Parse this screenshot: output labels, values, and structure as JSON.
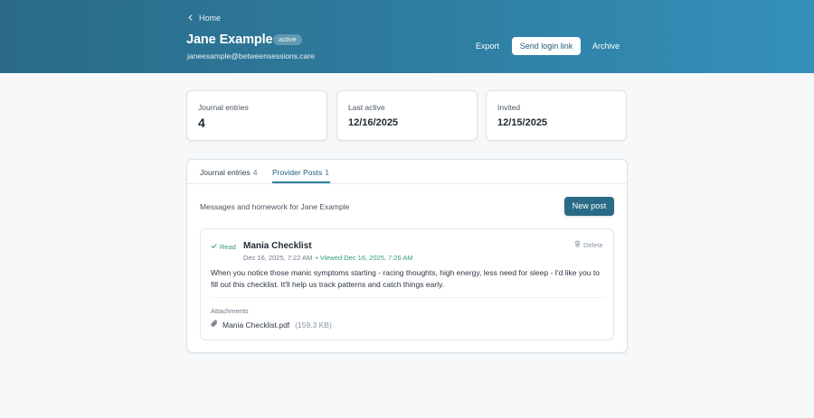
{
  "header": {
    "back_label": "Home",
    "patient_name": "Jane Example",
    "status": "active",
    "email": "janeexample@betweensessions.care",
    "export_label": "Export",
    "send_login_label": "Send login link",
    "archive_label": "Archive"
  },
  "stats": [
    {
      "label": "Journal entries",
      "value": "4"
    },
    {
      "label": "Last active",
      "value": "12/16/2025"
    },
    {
      "label": "Invited",
      "value": "12/15/2025"
    }
  ],
  "tabs": [
    {
      "label": "Journal entries",
      "count": "4"
    },
    {
      "label": "Provider Posts",
      "count": "1",
      "active": true
    }
  ],
  "posts_section": {
    "description": "Messages and homework for Jane Example",
    "new_post_label": "New post"
  },
  "post": {
    "read_label": "Read",
    "title": "Mania Checklist",
    "date": "Dec 16, 2025, 7:22 AM",
    "viewed": "• Viewed Dec 16, 2025, 7:26 AM",
    "delete_label": "Delete",
    "body": "When you notice those manic symptoms starting - racing thoughts, high energy, less need for sleep - I'd like you to fill out this checklist. It'll help us track patterns and catch things early.",
    "attachments_label": "Attachments",
    "attachment": {
      "name": "Mania Checklist.pdf",
      "size": "(159.3 KB)"
    }
  },
  "colors": {
    "header_start": "#2a6a87",
    "header_end": "#3591ba",
    "accent": "#2f7ea2",
    "button_primary": "#2b6a86",
    "read_green": "#2f9e6e"
  },
  "icons": {
    "back": "chevron-left-icon",
    "read": "check-icon",
    "delete": "trash-icon",
    "attachment": "paperclip-icon"
  }
}
